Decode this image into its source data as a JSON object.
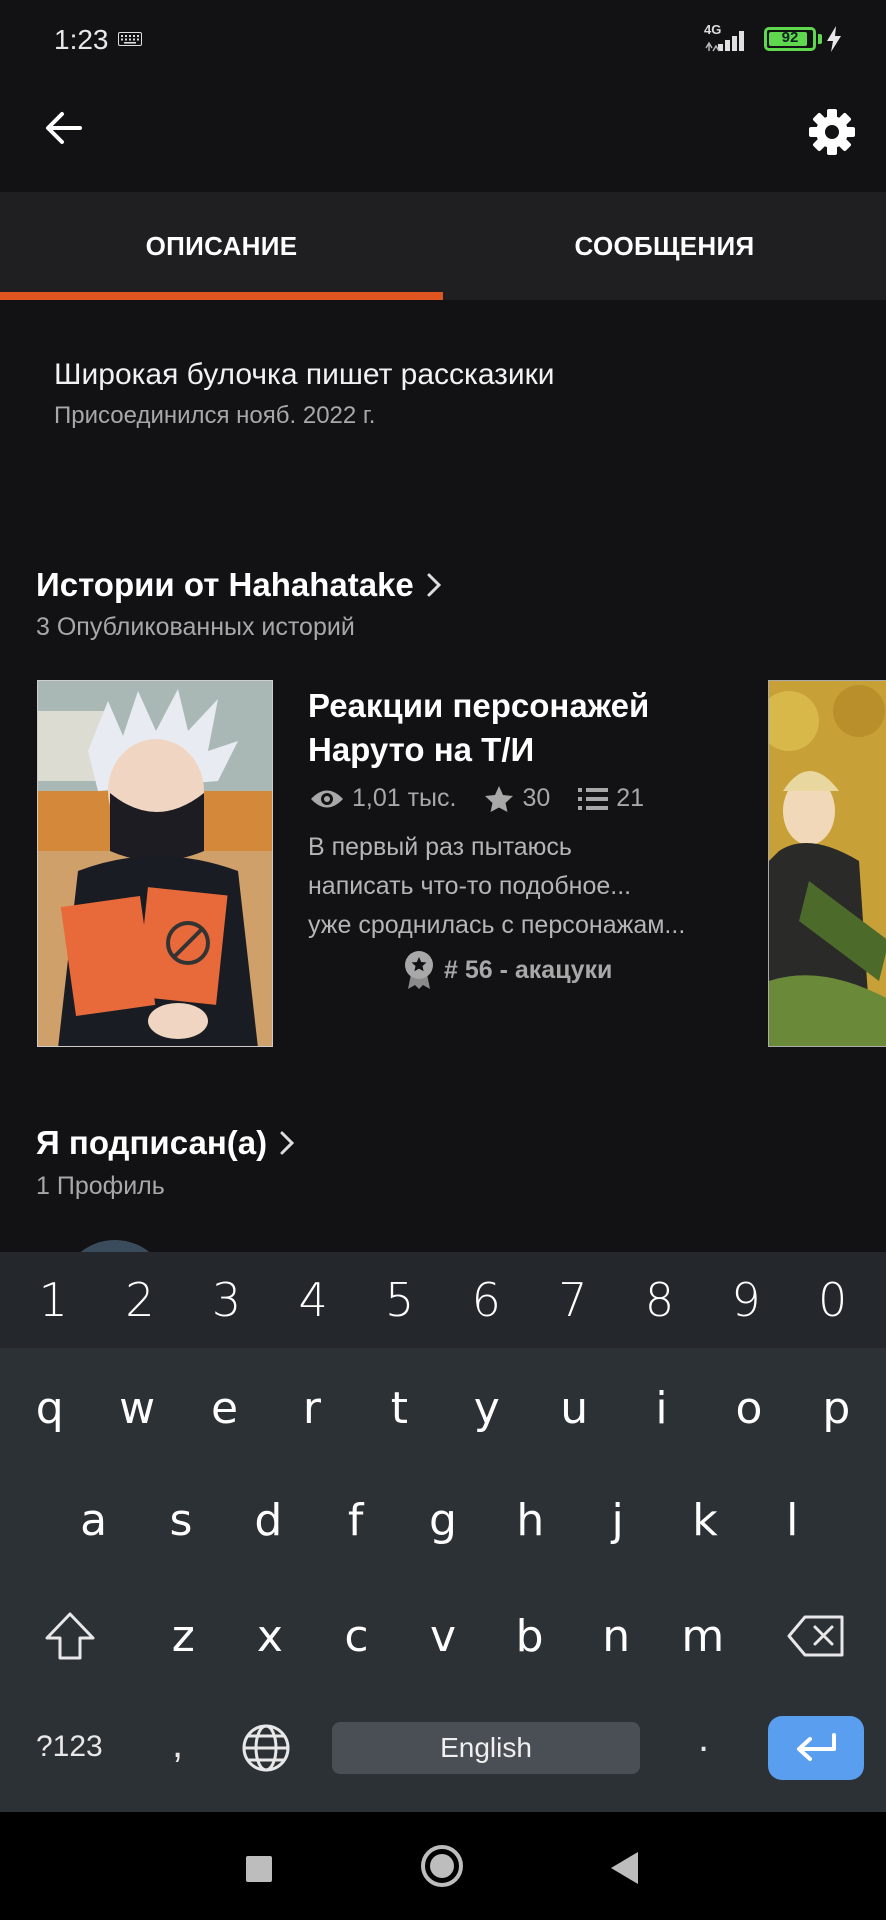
{
  "status_bar": {
    "time": "1:23",
    "network": "4G",
    "battery": "92",
    "battery_level": 0.92,
    "battery_color": "#5fd84d"
  },
  "tabs": [
    {
      "label": "ОПИСАНИЕ",
      "active": true
    },
    {
      "label": "СООБЩЕНИЯ",
      "active": false
    }
  ],
  "accent_color": "#e0541f",
  "about": {
    "name": "Широкая булочка пишет рассказики",
    "joined": "Присоединился нояб. 2022 г."
  },
  "stories_section": {
    "title": "Истории от Hahahatake",
    "subtitle": "3 Опубликованных историй",
    "story": {
      "title": "Реакции персонажей Наруто на Т/И",
      "views": "1,01 тыс.",
      "votes": "30",
      "parts": "21",
      "description_lines": [
        "В первый раз пытаюсь",
        "написать что-то подобное...",
        "уже сроднилась с персонажам..."
      ],
      "rank": "# 56 - акацуки"
    }
  },
  "following_section": {
    "title": "Я подписан(а)",
    "subtitle": "1 Профиль"
  },
  "keyboard": {
    "number_row": [
      "1",
      "2",
      "3",
      "4",
      "5",
      "6",
      "7",
      "8",
      "9",
      "0"
    ],
    "row1": [
      "q",
      "w",
      "e",
      "r",
      "t",
      "y",
      "u",
      "i",
      "o",
      "p"
    ],
    "row2": [
      "a",
      "s",
      "d",
      "f",
      "g",
      "h",
      "j",
      "k",
      "l"
    ],
    "row3": [
      "z",
      "x",
      "c",
      "v",
      "b",
      "n",
      "m"
    ],
    "symbols_label": "?123",
    "comma": ",",
    "space_label": "English",
    "period": ".",
    "enter_color": "#5a9ef0"
  }
}
